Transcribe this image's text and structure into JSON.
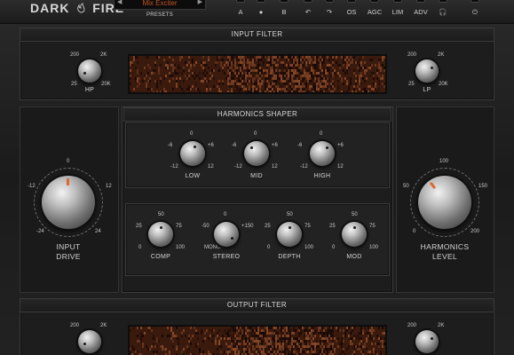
{
  "brand": {
    "left": "DARK",
    "right": "FIRE"
  },
  "presets": {
    "current": "Mix Exciter",
    "label": "PRESETS",
    "prev": "◀",
    "next": "▶"
  },
  "toolbar": [
    {
      "label": "A",
      "kind": "text"
    },
    {
      "label": "●",
      "kind": "copy-icon"
    },
    {
      "label": "B",
      "kind": "text"
    },
    {
      "label": "↶",
      "kind": "undo-icon"
    },
    {
      "label": "↷",
      "kind": "redo-icon"
    },
    {
      "label": "OS",
      "kind": "text"
    },
    {
      "label": "AGC",
      "kind": "text"
    },
    {
      "label": "LIM",
      "kind": "text"
    },
    {
      "label": "ADV",
      "kind": "text"
    },
    {
      "label": "🎧",
      "kind": "headphones-icon"
    },
    {
      "label": "⏻",
      "kind": "power-icon"
    }
  ],
  "input_filter": {
    "title": "INPUT FILTER",
    "hp": {
      "label": "HP",
      "scale": [
        "200",
        "2K",
        "25",
        "20K"
      ]
    },
    "lp": {
      "label": "LP",
      "scale": [
        "200",
        "2K",
        "25",
        "20K"
      ]
    }
  },
  "harmonics_shaper": {
    "title": "HARMONICS SHAPER",
    "eq": [
      {
        "label": "LOW",
        "top": "0",
        "left": "-6",
        "right": "+6",
        "bl": "-12",
        "br": "12"
      },
      {
        "label": "MID",
        "top": "0",
        "left": "-6",
        "right": "+6",
        "bl": "-12",
        "br": "12"
      },
      {
        "label": "HIGH",
        "top": "0",
        "left": "-6",
        "right": "+6",
        "bl": "-12",
        "br": "12"
      }
    ],
    "controls": [
      {
        "label": "COMP",
        "top": "50",
        "left": "25",
        "right": "75",
        "bl": "0",
        "br": "100"
      },
      {
        "label": "STEREO",
        "top": "0",
        "left": "-50",
        "right": "+150",
        "bl": "MONO",
        "br": ""
      },
      {
        "label": "DEPTH",
        "top": "50",
        "left": "25",
        "right": "75",
        "bl": "0",
        "br": "100"
      },
      {
        "label": "MOD",
        "top": "50",
        "left": "25",
        "right": "75",
        "bl": "0",
        "br": "100"
      }
    ]
  },
  "input_drive": {
    "label_1": "INPUT",
    "label_2": "DRIVE",
    "top": "0",
    "left": "-12",
    "right": "12",
    "bl": "-24",
    "br": "24"
  },
  "harmonics_level": {
    "label_1": "HARMONICS",
    "label_2": "LEVEL",
    "top": "100",
    "left": "50",
    "right": "150",
    "bl": "0",
    "br": "200"
  },
  "output_filter": {
    "title": "OUTPUT FILTER",
    "hp": {
      "scale": [
        "200",
        "2K"
      ]
    },
    "lp": {
      "scale": [
        "200",
        "2K"
      ]
    }
  },
  "colors": {
    "accent": "#e0672a",
    "preset_text": "#c2551f",
    "screen_bg": "#2a1208"
  }
}
